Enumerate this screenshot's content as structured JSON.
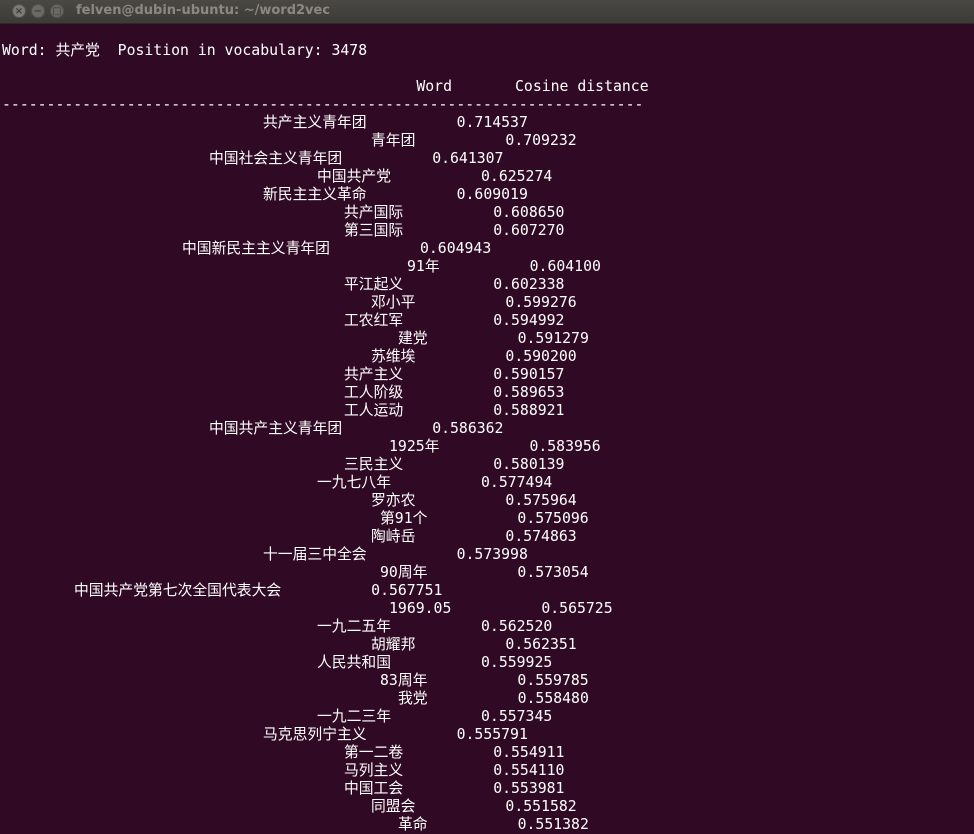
{
  "window": {
    "title": "felven@dubin-ubuntu: ~/word2vec",
    "close_glyph": "×",
    "minimize_glyph": "−",
    "maximize_glyph": "□"
  },
  "terminal": {
    "header": "Word: 共产党  Position in vocabulary: 3478",
    "col_word": "Word",
    "col_dist": "Cosine distance",
    "separator": "------------------------------------------------------------------------",
    "rows": [
      {
        "word": "共产主义青年团",
        "dist": "0.714537"
      },
      {
        "word": "青年团",
        "dist": "0.709232"
      },
      {
        "word": "中国社会主义青年团",
        "dist": "0.641307"
      },
      {
        "word": "中国共产党",
        "dist": "0.625274"
      },
      {
        "word": "新民主主义革命",
        "dist": "0.609019"
      },
      {
        "word": "共产国际",
        "dist": "0.608650"
      },
      {
        "word": "第三国际",
        "dist": "0.607270"
      },
      {
        "word": "中国新民主主义青年团",
        "dist": "0.604943"
      },
      {
        "word": "91年",
        "dist": "0.604100"
      },
      {
        "word": "平江起义",
        "dist": "0.602338"
      },
      {
        "word": "邓小平",
        "dist": "0.599276"
      },
      {
        "word": "工农红军",
        "dist": "0.594992"
      },
      {
        "word": "建党",
        "dist": "0.591279"
      },
      {
        "word": "苏维埃",
        "dist": "0.590200"
      },
      {
        "word": "共产主义",
        "dist": "0.590157"
      },
      {
        "word": "工人阶级",
        "dist": "0.589653"
      },
      {
        "word": "工人运动",
        "dist": "0.588921"
      },
      {
        "word": "中国共产主义青年团",
        "dist": "0.586362"
      },
      {
        "word": "1925年",
        "dist": "0.583956"
      },
      {
        "word": "三民主义",
        "dist": "0.580139"
      },
      {
        "word": "一九七八年",
        "dist": "0.577494"
      },
      {
        "word": "罗亦农",
        "dist": "0.575964"
      },
      {
        "word": "第91个",
        "dist": "0.575096"
      },
      {
        "word": "陶峙岳",
        "dist": "0.574863"
      },
      {
        "word": "十一届三中全会",
        "dist": "0.573998"
      },
      {
        "word": "90周年",
        "dist": "0.573054"
      },
      {
        "word": "中国共产党第七次全国代表大会",
        "dist": "0.567751"
      },
      {
        "word": "1969.05",
        "dist": "0.565725"
      },
      {
        "word": "一九二五年",
        "dist": "0.562520"
      },
      {
        "word": "胡耀邦",
        "dist": "0.562351"
      },
      {
        "word": "人民共和国",
        "dist": "0.559925"
      },
      {
        "word": "83周年",
        "dist": "0.559785"
      },
      {
        "word": "我党",
        "dist": "0.558480"
      },
      {
        "word": "一九二三年",
        "dist": "0.557345"
      },
      {
        "word": "马克思列宁主义",
        "dist": "0.555791"
      },
      {
        "word": "第一二卷",
        "dist": "0.554911"
      },
      {
        "word": "马列主义",
        "dist": "0.554110"
      },
      {
        "word": "中国工会",
        "dist": "0.553981"
      },
      {
        "word": "同盟会",
        "dist": "0.551582"
      },
      {
        "word": "革命",
        "dist": "0.551382"
      }
    ]
  }
}
